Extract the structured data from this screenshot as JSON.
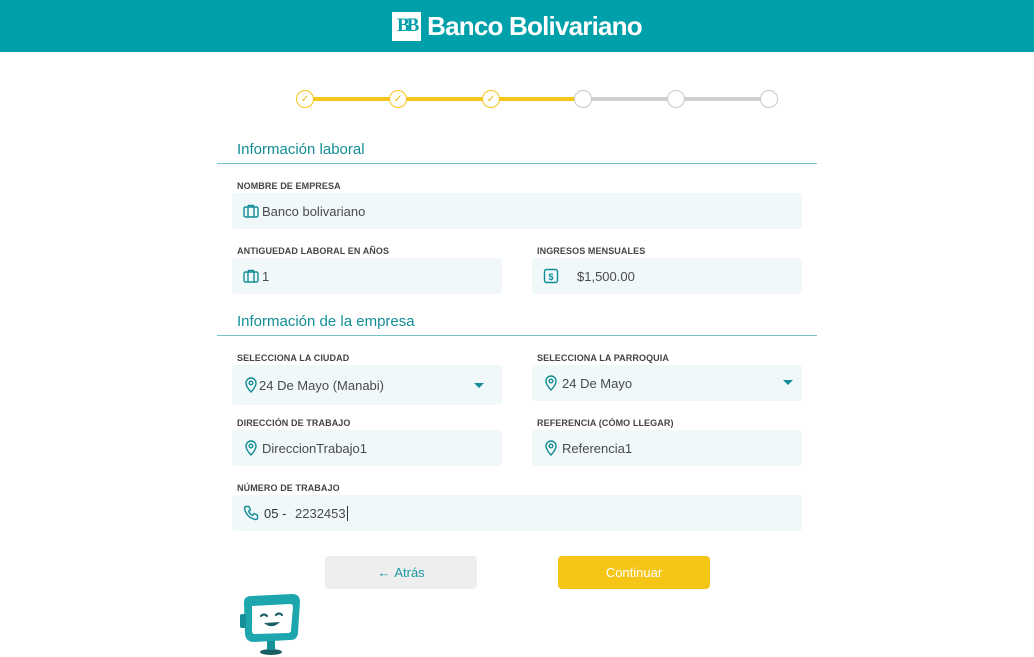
{
  "header": {
    "logo_mark": "BB",
    "brand": "Banco Bolivariano"
  },
  "stepper": {
    "total_steps": 6,
    "completed_steps": 3,
    "check_glyph": "✓"
  },
  "colors": {
    "primary": "#00a0aa",
    "accent": "#f5c518",
    "field_bg": "#f0f8fa"
  },
  "sections": {
    "laboral_title": "Información laboral",
    "empresa_title": "Información de la empresa"
  },
  "fields": {
    "empresa_label": "NOMBRE DE EMPRESA",
    "empresa_value": "Banco bolivariano",
    "antiguedad_label": "ANTIGUEDAD LABORAL EN AÑOS",
    "antiguedad_value": "1",
    "ingresos_label": "INGRESOS MENSUALES",
    "ingresos_value": "$1,500.00",
    "ciudad_label": "SELECCIONA LA CIUDAD",
    "ciudad_value": "24 De Mayo (Manabi)",
    "parroquia_label": "SELECCIONA LA PARROQUIA",
    "parroquia_value": "24 De Mayo",
    "direccion_label": "DIRECCIÓN DE TRABAJO",
    "direccion_value": "DireccionTrabajo1",
    "referencia_label": "REFERENCIA (CÓMO LLEGAR)",
    "referencia_value": "Referencia1",
    "telefono_label": "NÚMERO DE TRABAJO",
    "telefono_prefix": "05 -",
    "telefono_value": "2232453"
  },
  "buttons": {
    "back_label": "Atrás",
    "back_icon": "←",
    "next_label": "Continuar"
  },
  "icons": {
    "briefcase": "briefcase-icon",
    "dollar": "dollar-icon",
    "pin": "location-pin-icon",
    "phone": "phone-icon"
  }
}
